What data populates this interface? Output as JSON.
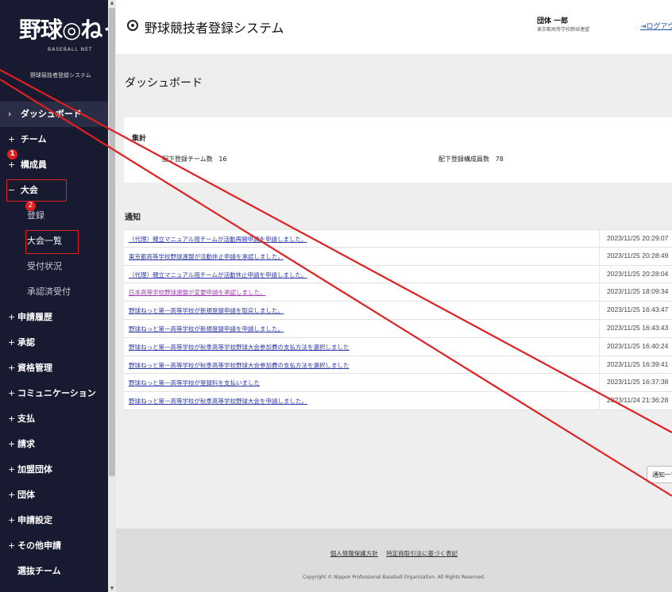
{
  "sidebar": {
    "logo_main": "野球◎ねっと",
    "logo_sub": "BASEBALL NET",
    "logo_system": "野球競技者登録システム",
    "items": [
      {
        "prefix": "›",
        "label": "ダッシュボード"
      },
      {
        "prefix": "+",
        "label": "チーム"
      },
      {
        "prefix": "+",
        "label": "構成員"
      },
      {
        "prefix": "−",
        "label": "大会"
      }
    ],
    "subitems": [
      "登録",
      "大会一覧",
      "受付状況",
      "承認済受付"
    ],
    "items2": [
      {
        "prefix": "+",
        "label": "申請履歴"
      },
      {
        "prefix": "+",
        "label": "承認"
      },
      {
        "prefix": "+",
        "label": "資格管理"
      },
      {
        "prefix": "+",
        "label": "コミュニケーション"
      },
      {
        "prefix": "+",
        "label": "支払"
      },
      {
        "prefix": "+",
        "label": "請求"
      },
      {
        "prefix": "+",
        "label": "加盟団体"
      },
      {
        "prefix": "+",
        "label": "団体"
      },
      {
        "prefix": "+",
        "label": "申請設定"
      },
      {
        "prefix": "+",
        "label": "その他申請"
      },
      {
        "prefix": "",
        "label": "選抜チーム"
      }
    ],
    "badge1": "1",
    "badge2": "2",
    "colors": {
      "background": "#171a30",
      "highlight": "#e02020"
    }
  },
  "header": {
    "title": "野球競技者登録システム",
    "user_name": "団体 一郎",
    "user_org": "東京都高等学校野球連盟",
    "logout": "ログアウト"
  },
  "main": {
    "page_title": "ダッシュボード",
    "summary": {
      "title": "集計",
      "team_label": "配下登録チーム数",
      "team_value": "16",
      "member_label": "配下登録構成員数",
      "member_value": "78"
    },
    "notices_heading": "通知",
    "notices": [
      {
        "text": "（代理）親立マニュアル用チームが活動再開申請を申請しました。",
        "date": "2023/11/25 20:29:07",
        "color": "blue"
      },
      {
        "text": "東京都高等学校野球連盟が活動休止申請を承認しました。",
        "date": "2023/11/25 20:28:49",
        "color": "blue"
      },
      {
        "text": "（代理）親立マニュアル用チームが活動休止申請を申請しました。",
        "date": "2023/11/25 20:28:04",
        "color": "blue"
      },
      {
        "text": "日本高等学校野球連盟が変更申請を承認しました。",
        "date": "2023/11/25 18:09:34",
        "color": "purple"
      },
      {
        "text": "野球ねっと第一高等学校が新規登録申請を取戻しました。",
        "date": "2023/11/25 16:43:47",
        "color": "blue"
      },
      {
        "text": "野球ねっと第一高等学校が新規登録申請を申請しました。",
        "date": "2023/11/25 16:43:43",
        "color": "blue"
      },
      {
        "text": "野球ねっと第一高等学校が秋季高等学校野球大会参加費の支払方法を選択しました",
        "date": "2023/11/25 16:40:24",
        "color": "blue"
      },
      {
        "text": "野球ねっと第一高等学校が秋季高等学校野球大会参加費の支払方法を選択しました",
        "date": "2023/11/25 16:39:41",
        "color": "blue"
      },
      {
        "text": "野球ねっと第一高等学校が登録料を支払いました",
        "date": "2023/11/25 16:37:38",
        "color": "blue"
      },
      {
        "text": "野球ねっと第一高等学校が秋季高等学校野球大会を申請しました。",
        "date": "2023/11/24 21:36:28",
        "color": "blue"
      }
    ],
    "list_button": "通知一覧"
  },
  "footer": {
    "link1": "個人情報保護方針",
    "link2": "特定商取引法に基づく表記",
    "copyright": "Copyright © Nippon Professional Baseball Organization. All Rights Reserved."
  }
}
